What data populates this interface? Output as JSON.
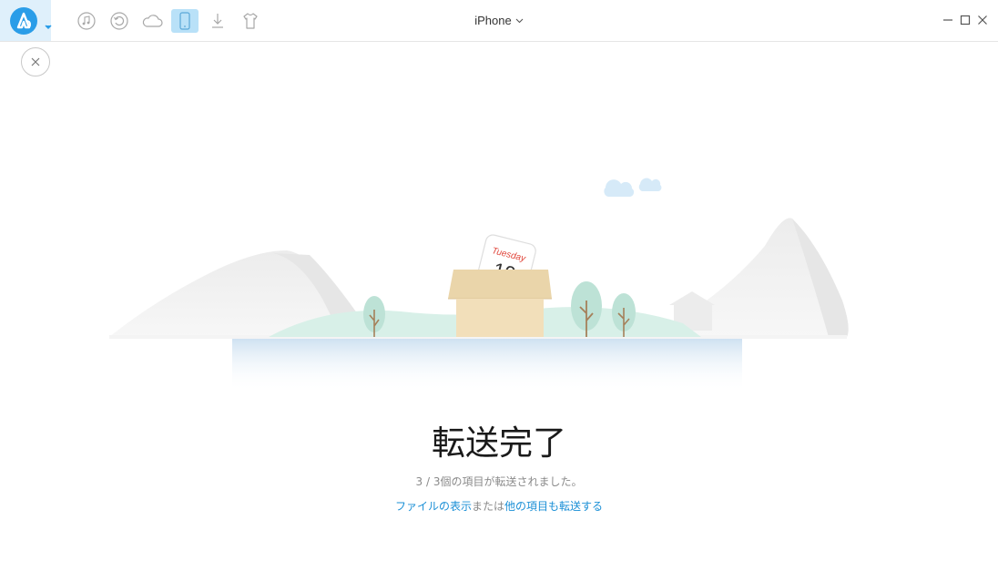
{
  "titlebar": {
    "device_name": "iPhone",
    "toolbar_icons": [
      "music-icon",
      "restore-icon",
      "cloud-icon",
      "phone-icon",
      "download-icon",
      "tshirt-icon"
    ],
    "active_icon": "phone-icon"
  },
  "illustration": {
    "calendar_day": "Tuesday",
    "calendar_date": "19"
  },
  "result": {
    "title": "転送完了",
    "message": "3 / 3個の項目が転送されました。",
    "link_view_files": "ファイルの表示",
    "link_or": "または",
    "link_transfer_more": "他の項目も転送する"
  },
  "colors": {
    "accent": "#2a9de8",
    "link": "#1a8fd6",
    "active_tab_bg": "#b9e1f8"
  }
}
